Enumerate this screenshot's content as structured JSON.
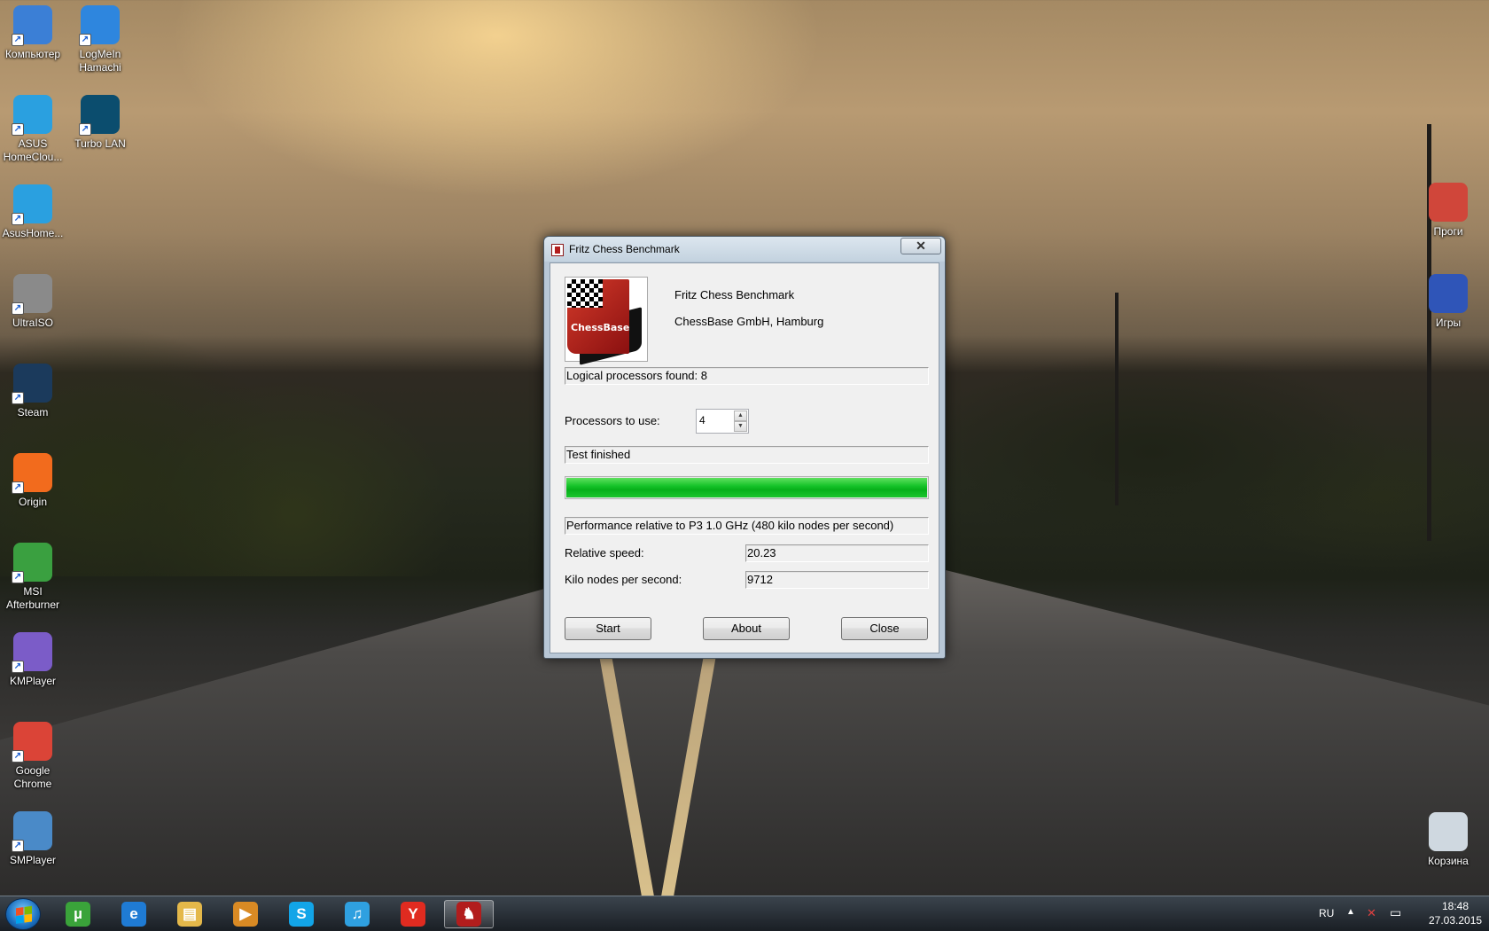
{
  "desktop": {
    "icons_left": [
      {
        "label": "Компьютер",
        "icon": "computer-icon",
        "color": "#3b7fd6"
      },
      {
        "label": "LogMeIn Hamachi",
        "icon": "hamachi-icon",
        "color": "#2e86de"
      },
      {
        "label": "ASUS HomeClou...",
        "icon": "asus-homecloud-icon",
        "color": "#2aa0e0"
      },
      {
        "label": "Turbo LAN",
        "icon": "turbo-lan-icon",
        "color": "#0b4d6e"
      },
      {
        "label": "AsusHome...",
        "icon": "asus-homecloud-icon",
        "color": "#2aa0e0"
      },
      {
        "label": "UltraISO",
        "icon": "ultraiso-icon",
        "color": "#8a8a8a"
      },
      {
        "label": "Steam",
        "icon": "steam-icon",
        "color": "#1b3a5c"
      },
      {
        "label": "Origin",
        "icon": "origin-icon",
        "color": "#f26b1d"
      },
      {
        "label": "MSI Afterburner",
        "icon": "msi-afterburner-icon",
        "color": "#3aa040"
      },
      {
        "label": "KMPlayer",
        "icon": "kmplayer-icon",
        "color": "#7b5cc8"
      },
      {
        "label": "Google Chrome",
        "icon": "chrome-icon",
        "color": "#db4437"
      },
      {
        "label": "SMPlayer",
        "icon": "smplayer-icon",
        "color": "#4a8ac8"
      }
    ],
    "icons_right": [
      {
        "label": "Проги",
        "icon": "programs-folder-icon",
        "color": "#d0463a"
      },
      {
        "label": "Игры",
        "icon": "games-folder-icon",
        "color": "#2f55b8"
      },
      {
        "label": "Корзина",
        "icon": "recycle-bin-icon",
        "color": "#cfd8e0"
      }
    ]
  },
  "dialog": {
    "title": "Fritz Chess Benchmark",
    "close_symbol": "✕",
    "product_name": "Fritz Chess Benchmark",
    "company": "ChessBase GmbH, Hamburg",
    "logo_text": "ChessBase",
    "logical_processors": "Logical processors found: 8",
    "processors_label": "Processors to use:",
    "processors_value": "4",
    "status": "Test finished",
    "progress_percent": 100,
    "performance_header": "Performance relative to P3 1.0 GHz (480 kilo nodes per second)",
    "relative_speed_label": "Relative speed:",
    "relative_speed_value": "20.23",
    "knps_label": "Kilo nodes per second:",
    "knps_value": "9712",
    "buttons": {
      "start": "Start",
      "about": "About",
      "close": "Close"
    }
  },
  "taskbar": {
    "items": [
      {
        "icon": "utorrent-icon",
        "glyph": "µ",
        "color": "#3aa33a"
      },
      {
        "icon": "internet-explorer-icon",
        "glyph": "e",
        "color": "#1f7bd4"
      },
      {
        "icon": "explorer-folder-icon",
        "glyph": "▤",
        "color": "#e4b84a"
      },
      {
        "icon": "media-player-icon",
        "glyph": "▶",
        "color": "#d98a24"
      },
      {
        "icon": "skype-icon",
        "glyph": "S",
        "color": "#12a5e8"
      },
      {
        "icon": "itunes-icon",
        "glyph": "♫",
        "color": "#2fa0e0"
      },
      {
        "icon": "yandex-browser-icon",
        "glyph": "Y",
        "color": "#e02b20"
      },
      {
        "icon": "fritz-benchmark-icon",
        "glyph": "♞",
        "color": "#b21d1d"
      }
    ],
    "language": "RU",
    "time": "18:48",
    "date": "27.03.2015"
  }
}
